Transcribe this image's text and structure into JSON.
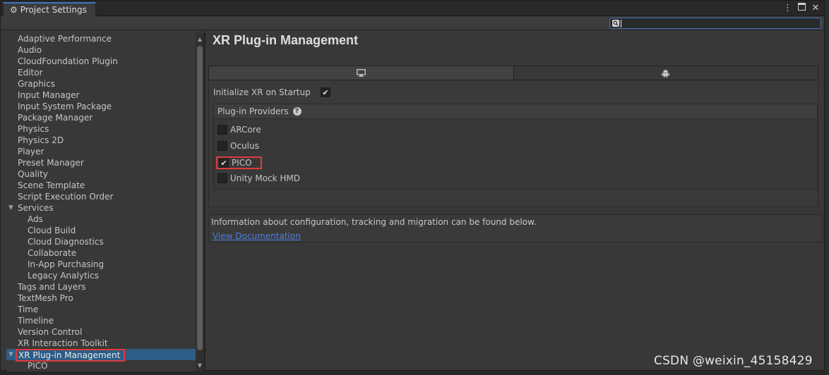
{
  "window": {
    "tab_label": "Project Settings",
    "tab_icon": "gear-icon",
    "menu_icon": "kebab-menu-icon",
    "maximize_icon": "maximize-icon",
    "close_icon": "close-icon"
  },
  "search": {
    "value": "",
    "placeholder": ""
  },
  "sidebar": {
    "items": [
      {
        "label": "Adaptive Performance",
        "level": 0
      },
      {
        "label": "Audio",
        "level": 0
      },
      {
        "label": "CloudFoundation Plugin",
        "level": 0
      },
      {
        "label": "Editor",
        "level": 0
      },
      {
        "label": "Graphics",
        "level": 0
      },
      {
        "label": "Input Manager",
        "level": 0
      },
      {
        "label": "Input System Package",
        "level": 0
      },
      {
        "label": "Package Manager",
        "level": 0
      },
      {
        "label": "Physics",
        "level": 0
      },
      {
        "label": "Physics 2D",
        "level": 0
      },
      {
        "label": "Player",
        "level": 0
      },
      {
        "label": "Preset Manager",
        "level": 0
      },
      {
        "label": "Quality",
        "level": 0
      },
      {
        "label": "Scene Template",
        "level": 0
      },
      {
        "label": "Script Execution Order",
        "level": 0
      },
      {
        "label": "Services",
        "level": 0,
        "expanded": true
      },
      {
        "label": "Ads",
        "level": 1
      },
      {
        "label": "Cloud Build",
        "level": 1
      },
      {
        "label": "Cloud Diagnostics",
        "level": 1
      },
      {
        "label": "Collaborate",
        "level": 1
      },
      {
        "label": "In-App Purchasing",
        "level": 1
      },
      {
        "label": "Legacy Analytics",
        "level": 1
      },
      {
        "label": "Tags and Layers",
        "level": 0
      },
      {
        "label": "TextMesh Pro",
        "level": 0
      },
      {
        "label": "Time",
        "level": 0
      },
      {
        "label": "Timeline",
        "level": 0
      },
      {
        "label": "Version Control",
        "level": 0
      },
      {
        "label": "XR Interaction Toolkit",
        "level": 0
      },
      {
        "label": "XR Plug-in Management",
        "level": 0,
        "expanded": true,
        "selected": true
      },
      {
        "label": "PICO",
        "level": 1
      }
    ]
  },
  "main": {
    "title": "XR Plug-in Management",
    "platform_tabs": [
      {
        "icon": "monitor-icon",
        "name": "standalone",
        "active": true
      },
      {
        "icon": "android-icon",
        "name": "android",
        "active": false
      }
    ],
    "initialize_label": "Initialize XR on Startup",
    "initialize_checked": true,
    "providers_header": "Plug-in Providers",
    "providers": [
      {
        "label": "ARCore",
        "checked": false
      },
      {
        "label": "Oculus",
        "checked": false
      },
      {
        "label": "PICO",
        "checked": true
      },
      {
        "label": "Unity Mock HMD",
        "checked": false
      }
    ],
    "info_text": "Information about configuration, tracking and migration can be found below.",
    "doc_link": "View Documentation"
  },
  "colors": {
    "highlight_box": "#e03b3b",
    "selection": "#2c5d87",
    "link": "#4c7ee0",
    "tab_accent": "#3a79bb"
  },
  "watermark": "CSDN @weixin_45158429"
}
